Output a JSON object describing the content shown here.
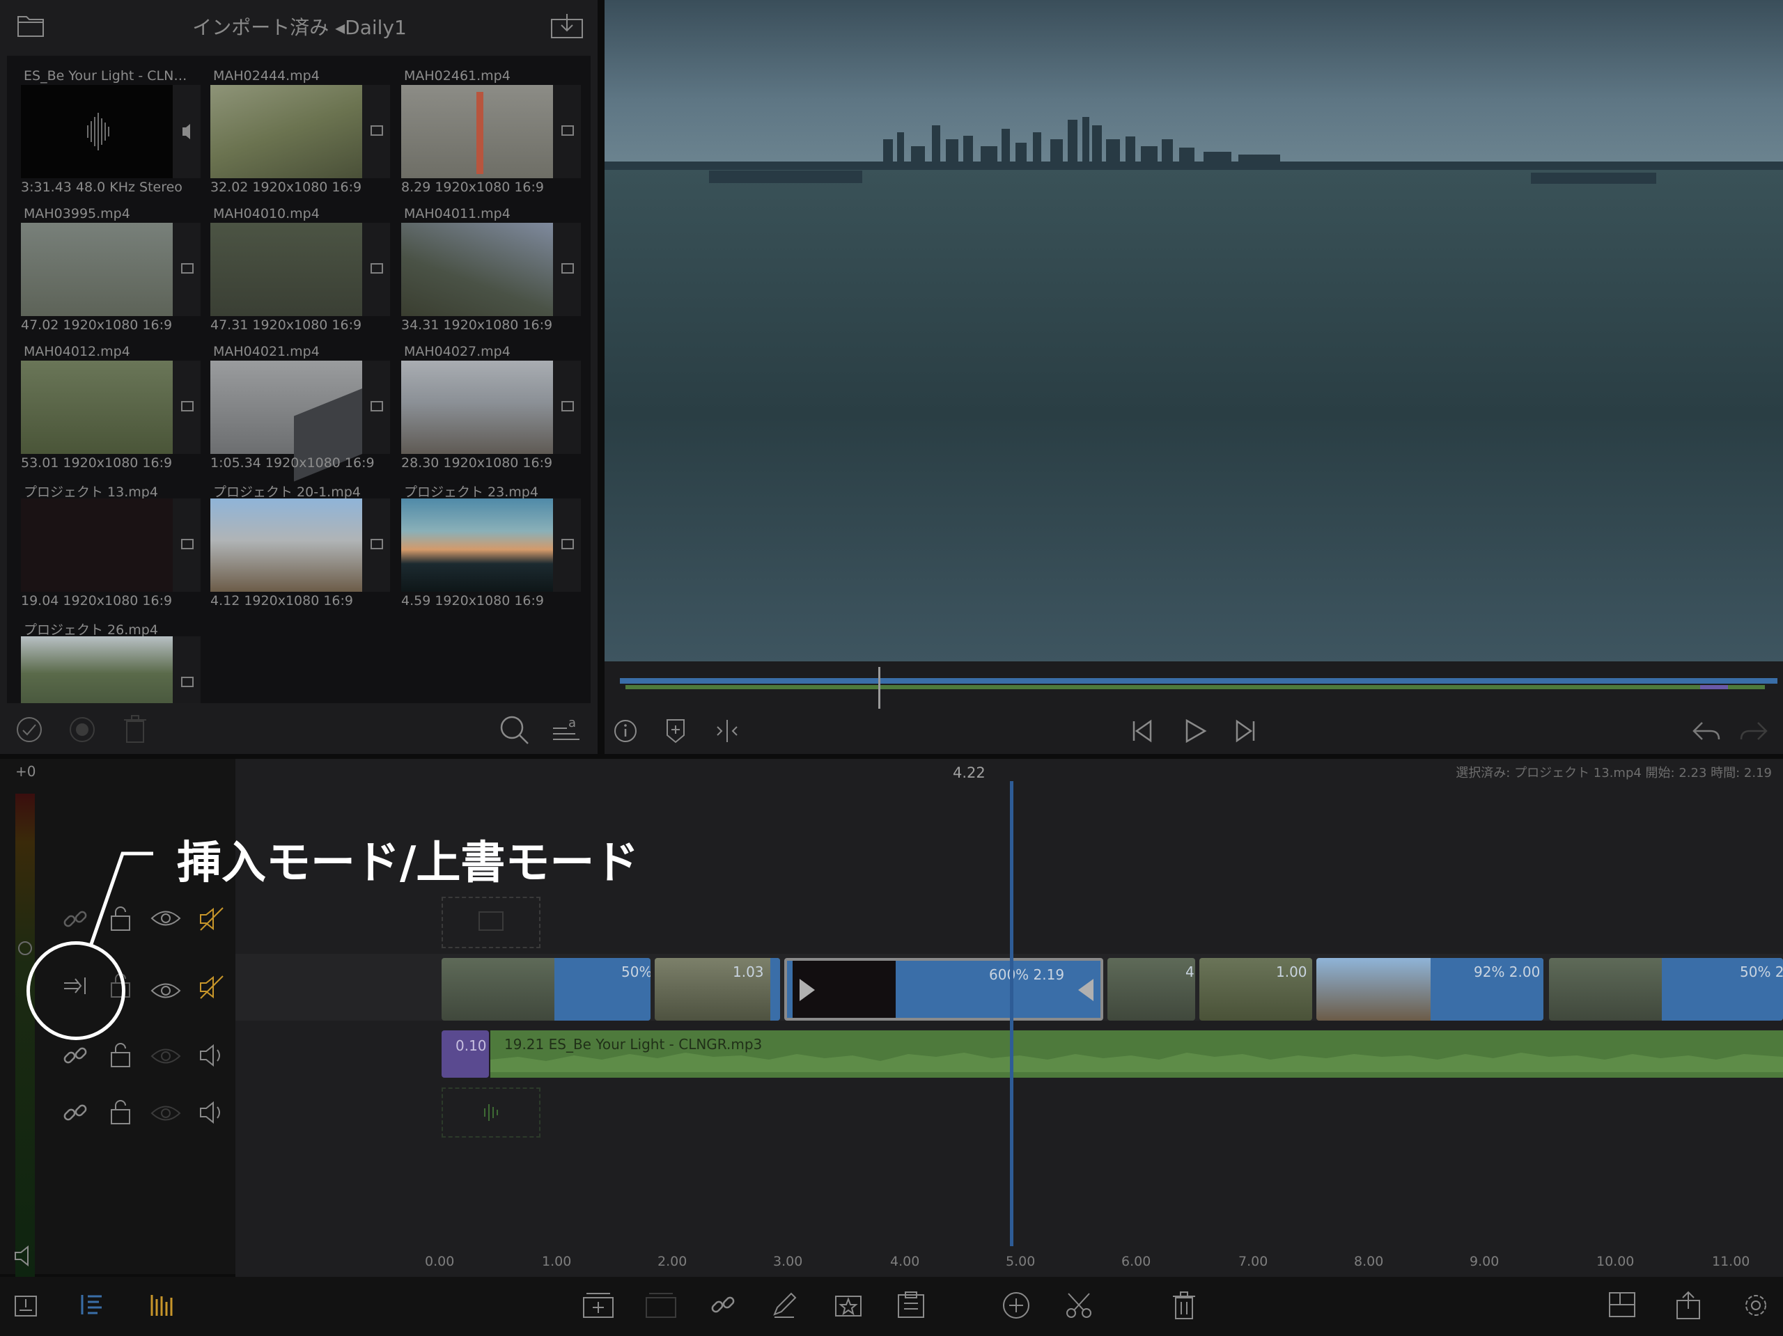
{
  "browser": {
    "title": "インポート済み ◂Daily1",
    "clips": [
      {
        "name": "ES_Be Your Light - CLNG...",
        "meta": "3:31.43  48.0 KHz  Stereo",
        "kind": "audio"
      },
      {
        "name": "MAH02444.mp4",
        "meta": "32.02  1920x1080  16:9",
        "kind": "video"
      },
      {
        "name": "MAH02461.mp4",
        "meta": "8.29  1920x1080  16:9",
        "kind": "video"
      },
      {
        "name": "MAH03995.mp4",
        "meta": "47.02  1920x1080  16:9",
        "kind": "video"
      },
      {
        "name": "MAH04010.mp4",
        "meta": "47.31  1920x1080  16:9",
        "kind": "video"
      },
      {
        "name": "MAH04011.mp4",
        "meta": "34.31  1920x1080  16:9",
        "kind": "video"
      },
      {
        "name": "MAH04012.mp4",
        "meta": "53.01  1920x1080  16:9",
        "kind": "video"
      },
      {
        "name": "MAH04021.mp4",
        "meta": "1:05.34  1920x1080  16:9",
        "kind": "video"
      },
      {
        "name": "MAH04027.mp4",
        "meta": "28.30  1920x1080  16:9",
        "kind": "video"
      },
      {
        "name": "プロジェクト 13.mp4",
        "meta": "19.04  1920x1080  16:9",
        "kind": "project"
      },
      {
        "name": "プロジェクト 20-1.mp4",
        "meta": "4.12  1920x1080  16:9",
        "kind": "project"
      },
      {
        "name": "プロジェクト 23.mp4",
        "meta": "4.59  1920x1080  16:9",
        "kind": "project"
      },
      {
        "name": "プロジェクト 26.mp4",
        "meta": "",
        "kind": "project"
      }
    ]
  },
  "timeline": {
    "level_offset": "+0",
    "playhead_time": "4.22",
    "selection_info": "選択済み: プロジェクト 13.mp4 開始: 2.23 時間: 2.19",
    "annotation": "挿入モード/上書モード",
    "ruler": [
      "0.00",
      "1.00",
      "2.00",
      "3.00",
      "4.00",
      "5.00",
      "6.00",
      "7.00",
      "8.00",
      "9.00",
      "10.00",
      "11.00"
    ],
    "video_clips": [
      {
        "label": "50%"
      },
      {
        "label": "1.03"
      },
      {
        "label": "600%   2.19"
      },
      {
        "label": "4"
      },
      {
        "label": "1.00"
      },
      {
        "label": "92%   2.00"
      },
      {
        "label": "50%   2."
      }
    ],
    "audio_clip": {
      "fade_label": "0.10",
      "label": "19.21  ES_Be Your Light - CLNGR.mp3"
    }
  },
  "colors": {
    "accent": "#3a6ea8",
    "audio": "#4e7a3c",
    "annotation": "#ffffff",
    "muted": "#c8962a"
  }
}
